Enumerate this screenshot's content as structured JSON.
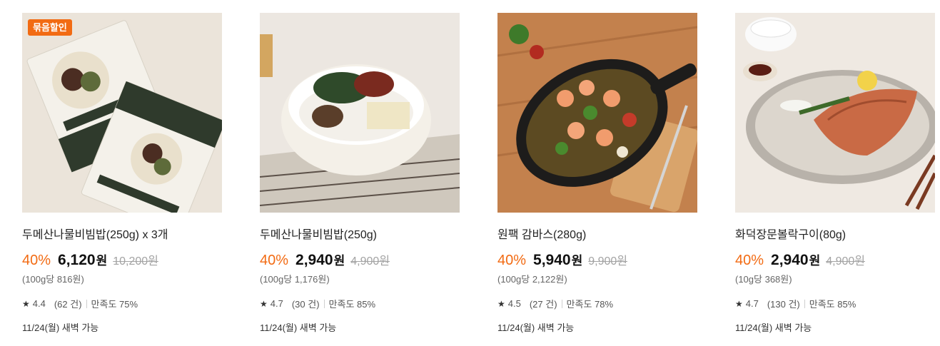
{
  "products": [
    {
      "badge": "묶음할인",
      "title": "두메산나물비빔밥(250g) x 3개",
      "discount": "40%",
      "price": "6,120",
      "currency": "원",
      "original_price": "10,200원",
      "unit_price": "(100g당 816원)",
      "rating": "4.4",
      "reviews": "(62 건)",
      "satisfaction": "만족도 75%",
      "delivery": "11/24(월) 새벽 가능",
      "image_icon": "boxed-bibimbap-pack-image"
    },
    {
      "badge": "",
      "title": "두메산나물비빔밥(250g)",
      "discount": "40%",
      "price": "2,940",
      "currency": "원",
      "original_price": "4,900원",
      "unit_price": "(100g당 1,176원)",
      "rating": "4.7",
      "reviews": "(30 건)",
      "satisfaction": "만족도 85%",
      "delivery": "11/24(월) 새벽 가능",
      "image_icon": "bibimbap-bowl-image"
    },
    {
      "badge": "",
      "title": "원팩 감바스(280g)",
      "discount": "40%",
      "price": "5,940",
      "currency": "원",
      "original_price": "9,900원",
      "unit_price": "(100g당 2,122원)",
      "rating": "4.5",
      "reviews": "(27 건)",
      "satisfaction": "만족도 78%",
      "delivery": "11/24(월) 새벽 가능",
      "image_icon": "gambas-skillet-image"
    },
    {
      "badge": "",
      "title": "화덕장문볼락구이(80g)",
      "discount": "40%",
      "price": "2,940",
      "currency": "원",
      "original_price": "4,900원",
      "unit_price": "(10g당 368원)",
      "rating": "4.7",
      "reviews": "(130 건)",
      "satisfaction": "만족도 85%",
      "delivery": "11/24(월) 새벽 가능",
      "image_icon": "grilled-fish-plate-image"
    }
  ],
  "colors": {
    "accent": "#f26b13",
    "strike": "#a3a3a3"
  },
  "icons": {
    "star": "star-icon"
  }
}
